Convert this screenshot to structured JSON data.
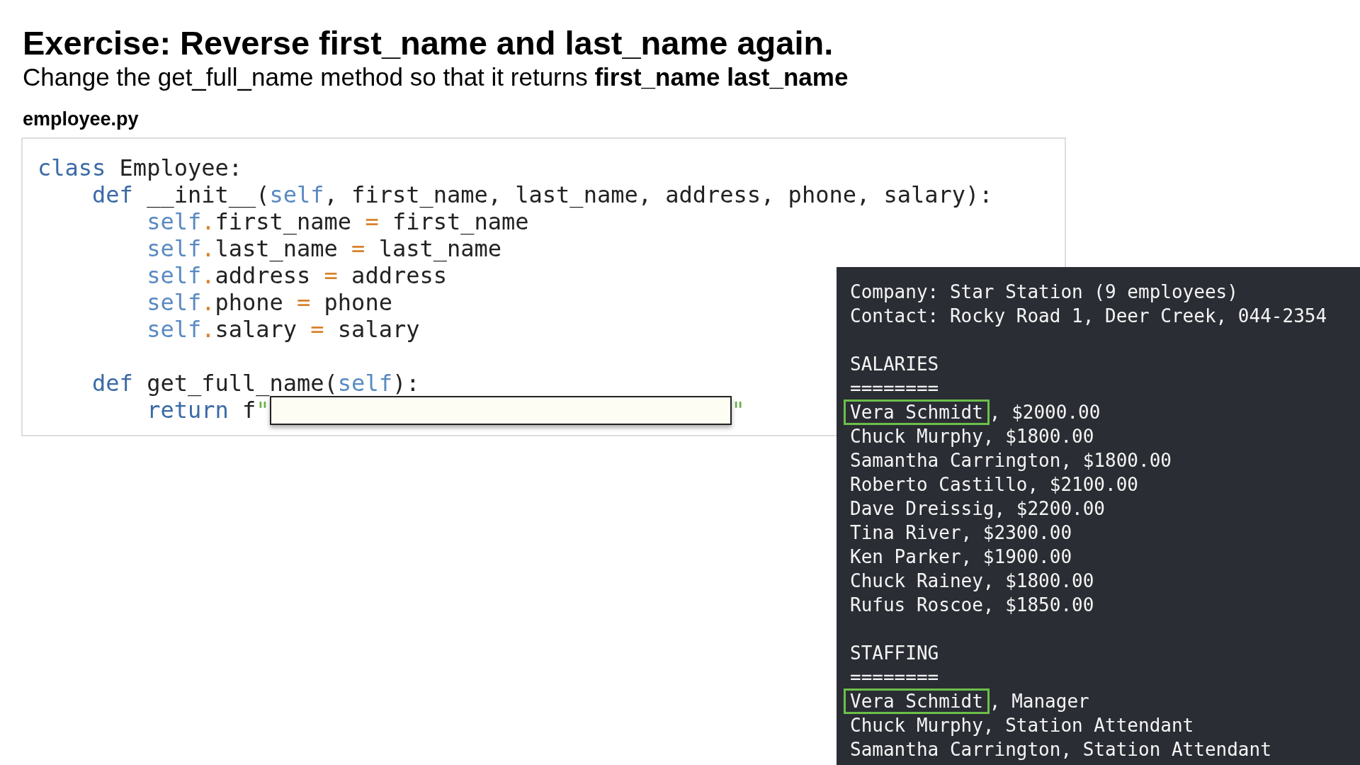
{
  "heading": "Exercise: Reverse first_name and last_name again.",
  "instruction": "Change the get_full_name method so that it returns **first_name last_name**",
  "file_name": "employee.py",
  "code_lines": [
    {
      "kind": "code",
      "tokens": [
        {
          "kind": "keyword",
          "text": "class"
        },
        {
          "kind": "plain",
          "text": " Employee:"
        }
      ],
      "children": [
        {
          "kind": "code",
          "tokens": [
            {
              "kind": "keyword",
              "text": "def"
            },
            {
              "kind": "plain",
              "text": " __init__("
            },
            {
              "kind": "self",
              "text": "self"
            },
            {
              "kind": "plain",
              "text": ", first_name, last_name, address, phone, salary):"
            }
          ],
          "children": [
            {
              "kind": "code",
              "tokens": [
                {
                  "kind": "self",
                  "text": "self"
                },
                {
                  "kind": "operator",
                  "text": "."
                },
                {
                  "kind": "plain",
                  "text": "first_name "
                },
                {
                  "kind": "operator",
                  "text": "="
                },
                {
                  "kind": "plain",
                  "text": " first_name"
                }
              ]
            },
            {
              "kind": "code",
              "tokens": [
                {
                  "kind": "self",
                  "text": "self"
                },
                {
                  "kind": "operator",
                  "text": "."
                },
                {
                  "kind": "plain",
                  "text": "last_name "
                },
                {
                  "kind": "operator",
                  "text": "="
                },
                {
                  "kind": "plain",
                  "text": " last_name"
                }
              ]
            },
            {
              "kind": "code",
              "tokens": [
                {
                  "kind": "self",
                  "text": "self"
                },
                {
                  "kind": "operator",
                  "text": "."
                },
                {
                  "kind": "plain",
                  "text": "address "
                },
                {
                  "kind": "operator",
                  "text": "="
                },
                {
                  "kind": "plain",
                  "text": " address"
                }
              ]
            },
            {
              "kind": "code",
              "tokens": [
                {
                  "kind": "self",
                  "text": "self"
                },
                {
                  "kind": "operator",
                  "text": "."
                },
                {
                  "kind": "plain",
                  "text": "phone "
                },
                {
                  "kind": "operator",
                  "text": "="
                },
                {
                  "kind": "plain",
                  "text": " phone"
                }
              ]
            },
            {
              "kind": "code",
              "tokens": [
                {
                  "kind": "self",
                  "text": "self"
                },
                {
                  "kind": "operator",
                  "text": "."
                },
                {
                  "kind": "plain",
                  "text": "salary "
                },
                {
                  "kind": "operator",
                  "text": "="
                },
                {
                  "kind": "plain",
                  "text": " salary"
                }
              ]
            }
          ]
        },
        {
          "kind": "blank"
        },
        {
          "kind": "code",
          "tokens": [
            {
              "kind": "keyword",
              "text": "def"
            },
            {
              "kind": "plain",
              "text": " get_full_name("
            },
            {
              "kind": "self",
              "text": "self"
            },
            {
              "kind": "plain",
              "text": "):"
            }
          ],
          "children": [
            {
              "kind": "code",
              "tokens": [
                {
                  "kind": "keyword",
                  "text": "return"
                },
                {
                  "kind": "plain",
                  "text": " f"
                },
                {
                  "kind": "string",
                  "text": "\""
                },
                {
                  "kind": "field"
                },
                {
                  "kind": "string",
                  "text": "\""
                }
              ]
            }
          ]
        }
      ]
    }
  ],
  "output_lines": [
    {
      "kind": "text",
      "text": "Company: Star Station (9 employees)"
    },
    {
      "kind": "text",
      "text": "Contact: Rocky Road 1, Deer Creek, 044-2354"
    },
    {
      "kind": "blank"
    },
    {
      "kind": "text",
      "text": "SALARIES"
    },
    {
      "kind": "text",
      "text": "========"
    },
    {
      "kind": "row",
      "name": "Vera Schmidt",
      "detail": ", $2000.00",
      "highlighted": true
    },
    {
      "kind": "row",
      "name": "Chuck Murphy",
      "detail": ", $1800.00",
      "highlighted": false
    },
    {
      "kind": "row",
      "name": "Samantha Carrington",
      "detail": ", $1800.00",
      "highlighted": false
    },
    {
      "kind": "row",
      "name": "Roberto Castillo",
      "detail": ", $2100.00",
      "highlighted": false
    },
    {
      "kind": "row",
      "name": "Dave Dreissig",
      "detail": ", $2200.00",
      "highlighted": false
    },
    {
      "kind": "row",
      "name": "Tina River",
      "detail": ", $2300.00",
      "highlighted": false
    },
    {
      "kind": "row",
      "name": "Ken Parker",
      "detail": ", $1900.00",
      "highlighted": false
    },
    {
      "kind": "row",
      "name": "Chuck Rainey",
      "detail": ", $1800.00",
      "highlighted": false
    },
    {
      "kind": "row",
      "name": "Rufus Roscoe",
      "detail": ", $1850.00",
      "highlighted": false
    },
    {
      "kind": "blank"
    },
    {
      "kind": "text",
      "text": "STAFFING"
    },
    {
      "kind": "text",
      "text": "========"
    },
    {
      "kind": "row",
      "name": "Vera Schmidt",
      "detail": ", Manager",
      "highlighted": true
    },
    {
      "kind": "row",
      "name": "Chuck Murphy",
      "detail": ", Station Attendant",
      "highlighted": false
    },
    {
      "kind": "row",
      "name": "Samantha Carrington",
      "detail": ", Station Attendant",
      "highlighted": false
    }
  ]
}
